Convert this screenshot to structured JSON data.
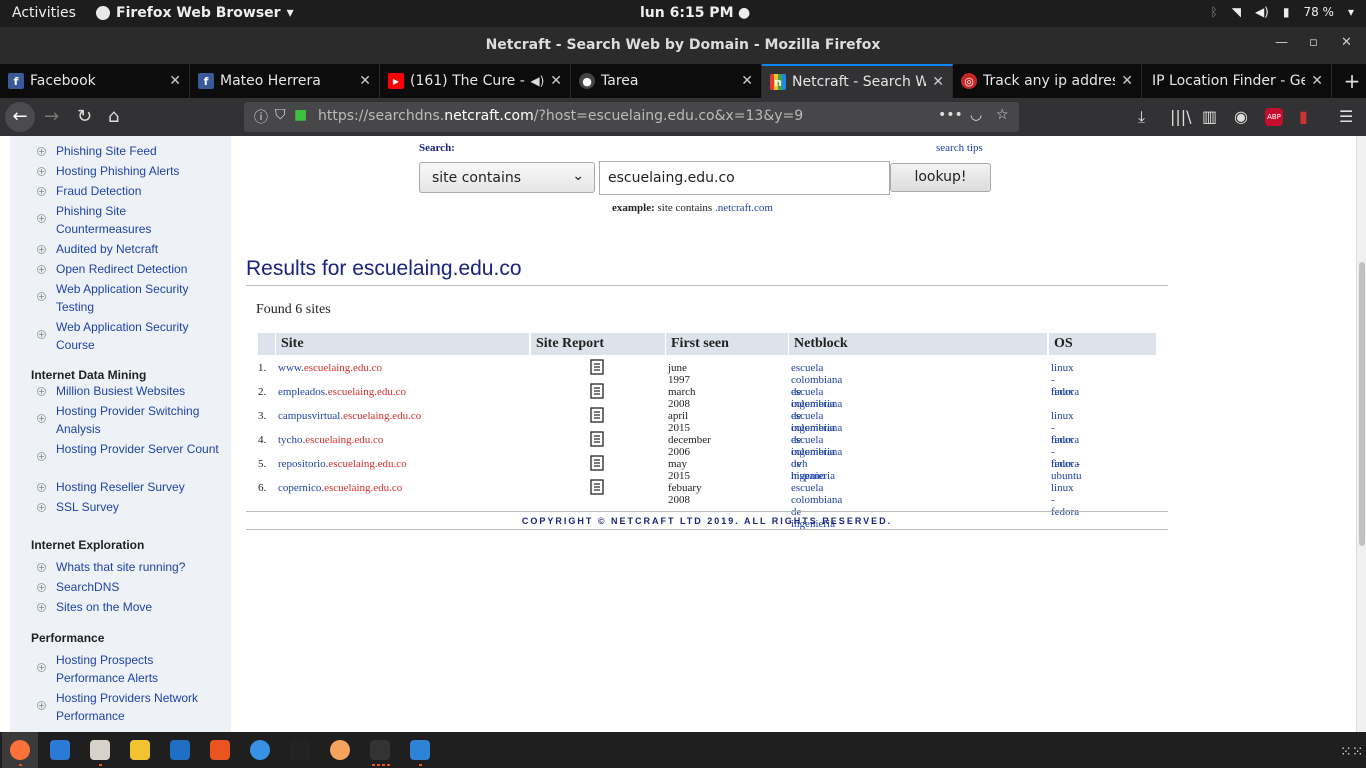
{
  "topbar": {
    "activities": "Activities",
    "app_menu": "Firefox Web Browser",
    "clock": "lun  6:15 PM",
    "battery": "78 %"
  },
  "window": {
    "title": "Netcraft - Search Web by Domain - Mozilla Firefox"
  },
  "tabs": [
    {
      "label": "Facebook",
      "icon": "facebook-icon",
      "color": "#3b5998"
    },
    {
      "label": "Mateo Herrera",
      "icon": "facebook-icon",
      "color": "#3b5998"
    },
    {
      "label": "(161) The Cure - L",
      "icon": "youtube-icon",
      "color": "#ff0000"
    },
    {
      "label": "Tarea",
      "icon": "github-icon",
      "color": "#444444"
    },
    {
      "label": "Netcraft - Search W",
      "icon": "netcraft-icon",
      "color": "#ffcc00"
    },
    {
      "label": "Track any ip addres",
      "icon": "target-icon",
      "color": "#c62828"
    },
    {
      "label": "IP Location Finder - Ge",
      "icon": "",
      "color": ""
    }
  ],
  "urlbar": {
    "prefix": "https://searchdns.",
    "domain": "netcraft.com",
    "suffix": "/?host=escuelaing.edu.co&x=13&y=9"
  },
  "sidebar": {
    "items_top": [
      "Phishing Site Feed",
      "Hosting Phishing Alerts",
      "Fraud Detection",
      "Phishing Site Countermeasures",
      "Audited by Netcraft",
      "Open Redirect Detection",
      "Web Application Security Testing",
      "Web Application Security Course"
    ],
    "sections": [
      {
        "title": "Internet Data Mining",
        "items": [
          "Million Busiest Websites",
          "Hosting Provider Switching Analysis",
          "Hosting Provider Server Count",
          "Hosting Reseller Survey",
          "SSL Survey"
        ]
      },
      {
        "title": "Internet Exploration",
        "items": [
          "Whats that site running?",
          "SearchDNS",
          "Sites on the Move"
        ]
      },
      {
        "title": "Performance",
        "items": [
          "Hosting Prospects Performance Alerts",
          "Hosting Providers Network Performance"
        ]
      }
    ]
  },
  "search": {
    "label": "Search:",
    "tips": "search tips",
    "mode": "site contains",
    "query": "escuelaing.edu.co",
    "button": "lookup!",
    "example_label": "example:",
    "example_text": "site contains",
    "example_link": ".netcraft.com"
  },
  "results": {
    "heading": "Results for escuelaing.edu.co",
    "found": "Found 6 sites",
    "columns": [
      "Site",
      "Site Report",
      "First seen",
      "Netblock",
      "OS"
    ],
    "rows": [
      {
        "num": "1.",
        "prefix": "www.",
        "domain": "escuelaing.edu.co",
        "first_seen": "june 1997",
        "netblock": "escuela colombiana de ingenieria",
        "os": "linux - fedora"
      },
      {
        "num": "2.",
        "prefix": "empleados.",
        "domain": "escuelaing.edu.co",
        "first_seen": "march 2008",
        "netblock": "escuela colombiana de ingenieria",
        "os": "linux"
      },
      {
        "num": "3.",
        "prefix": "campusvirtual.",
        "domain": "escuelaing.edu.co",
        "first_seen": "april 2015",
        "netblock": "escuela colombiana de ingenieria",
        "os": "linux - fedora"
      },
      {
        "num": "4.",
        "prefix": "tycho.",
        "domain": "escuelaing.edu.co",
        "first_seen": "december 2006",
        "netblock": "escuela colombiana de ingenieria",
        "os": "linux - fedora"
      },
      {
        "num": "5.",
        "prefix": "repositorio.",
        "domain": "escuelaing.edu.co",
        "first_seen": "may 2015",
        "netblock": "ovh hispano",
        "os": "linux - ubuntu"
      },
      {
        "num": "6.",
        "prefix": "copernico.",
        "domain": "escuelaing.edu.co",
        "first_seen": "febuary 2008",
        "netblock": "escuela colombiana de ingenieria",
        "os": "linux - fedora"
      }
    ],
    "copyright": "COPYRIGHT © NETCRAFT LTD 2019. ALL RIGHTS RESERVED."
  },
  "dock": [
    "firefox-icon",
    "thunderbird-icon",
    "files-icon",
    "rhythmbox-icon",
    "writer-icon",
    "software-center-icon",
    "help-icon",
    "amazon-icon",
    "mango-icon",
    "terminal-icon",
    "system-monitor-icon"
  ]
}
